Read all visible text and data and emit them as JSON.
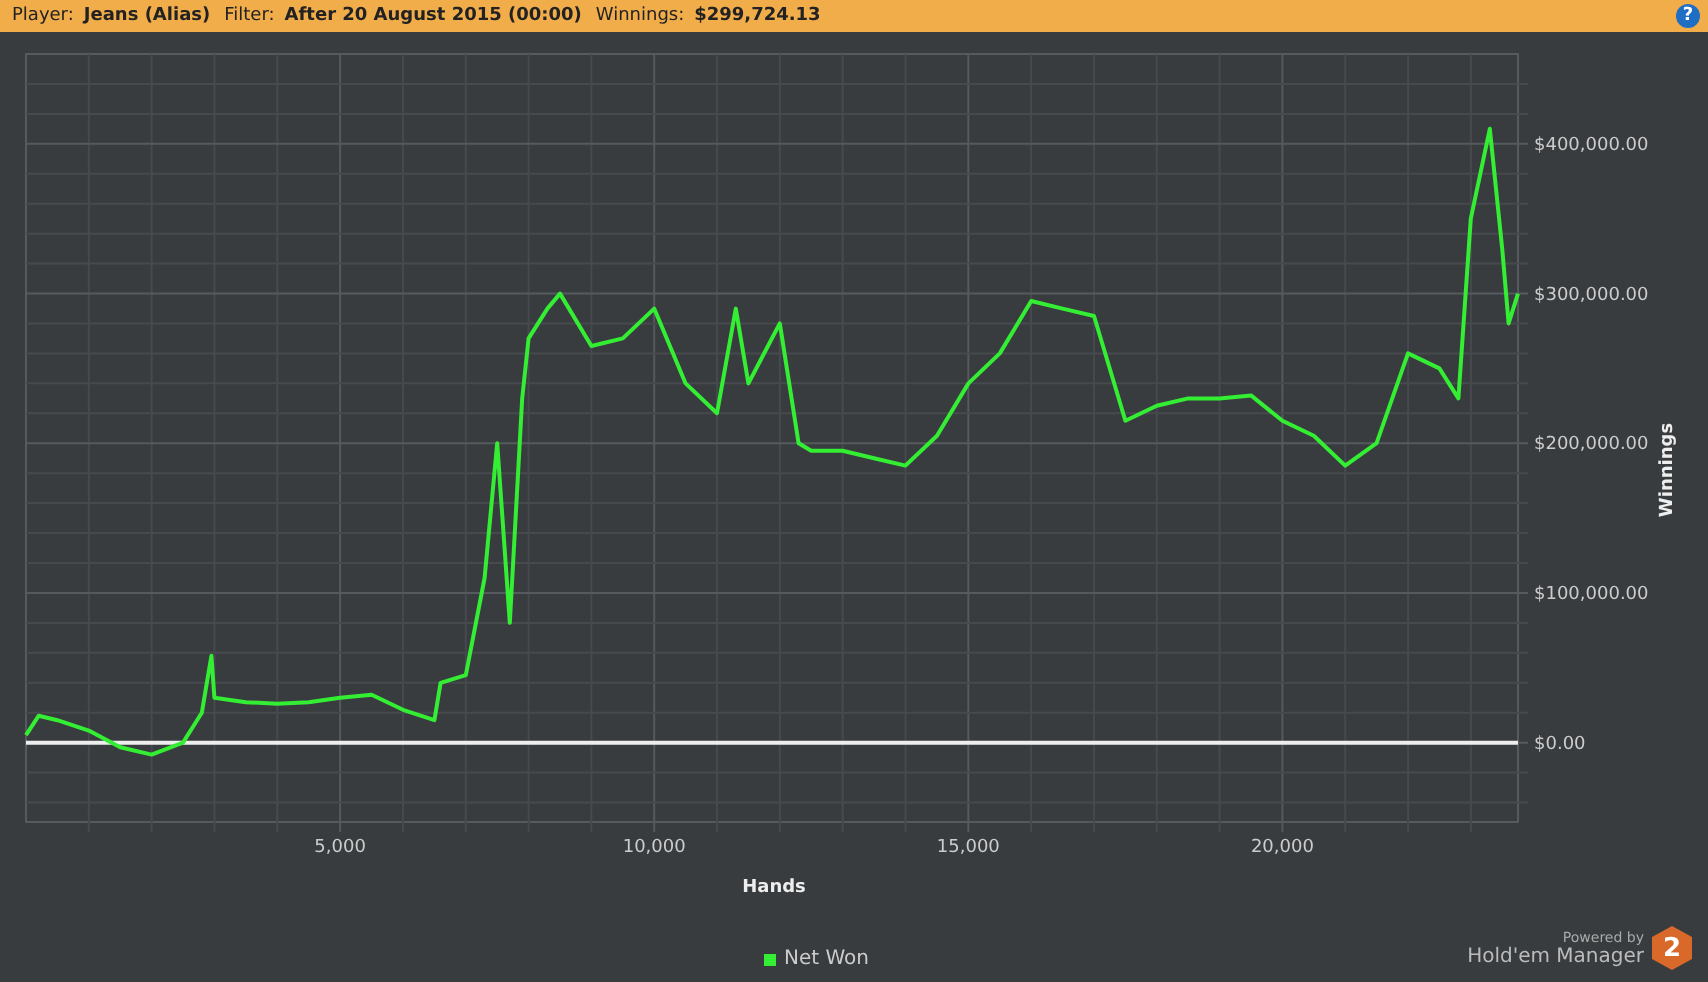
{
  "header": {
    "fields": [
      {
        "label": "Player:",
        "value": "Jeans (Alias)"
      },
      {
        "label": "Filter:",
        "value": "After 20 August 2015 (00:00)"
      },
      {
        "label": "Winnings:",
        "value": "$299,724.13"
      }
    ],
    "help": "?"
  },
  "chart": {
    "chart_data": {
      "type": "line",
      "grid": true,
      "xlabel": "Hands",
      "ylabel": "Winnings",
      "xlim": [
        0,
        23750
      ],
      "ylim": [
        -53000,
        460000
      ],
      "xticks": [
        {
          "value": 5000,
          "label": "5,000"
        },
        {
          "value": 10000,
          "label": "10,000"
        },
        {
          "value": 15000,
          "label": "15,000"
        },
        {
          "value": 20000,
          "label": "20,000"
        }
      ],
      "yticks": [
        {
          "value": 0,
          "label": "$0.00"
        },
        {
          "value": 100000,
          "label": "$100,000.00"
        },
        {
          "value": 200000,
          "label": "$200,000.00"
        },
        {
          "value": 300000,
          "label": "$300,000.00"
        },
        {
          "value": 400000,
          "label": "$400,000.00"
        }
      ],
      "x": [
        0,
        200,
        500,
        1000,
        1500,
        2000,
        2500,
        2800,
        2950,
        3000,
        3500,
        4000,
        4500,
        5000,
        5500,
        6000,
        6500,
        6600,
        7000,
        7300,
        7500,
        7700,
        7900,
        8000,
        8300,
        8500,
        9000,
        9500,
        10000,
        10500,
        11000,
        11300,
        11500,
        12000,
        12300,
        12500,
        13000,
        13500,
        14000,
        14500,
        15000,
        15500,
        16000,
        16500,
        17000,
        17500,
        18000,
        18500,
        19000,
        19500,
        20000,
        20500,
        21000,
        21500,
        22000,
        22500,
        22800,
        23000,
        23300,
        23500,
        23600,
        23750
      ],
      "series": [
        {
          "name": "Net Won",
          "color": "#33ee33",
          "values": [
            5000,
            18000,
            15000,
            8000,
            -3000,
            -8000,
            0,
            20000,
            58000,
            30000,
            27000,
            26000,
            27000,
            30000,
            32000,
            22000,
            15000,
            40000,
            45000,
            110000,
            200000,
            80000,
            230000,
            270000,
            290000,
            300000,
            265000,
            270000,
            290000,
            240000,
            220000,
            290000,
            240000,
            280000,
            200000,
            195000,
            195000,
            190000,
            185000,
            205000,
            240000,
            260000,
            295000,
            290000,
            285000,
            215000,
            225000,
            230000,
            230000,
            232000,
            215000,
            205000,
            185000,
            200000,
            260000,
            250000,
            230000,
            350000,
            410000,
            330000,
            280000,
            300000
          ]
        }
      ]
    }
  },
  "branding": {
    "tagline": "Powered by",
    "name": "Hold'em Manager",
    "badge": "2"
  }
}
